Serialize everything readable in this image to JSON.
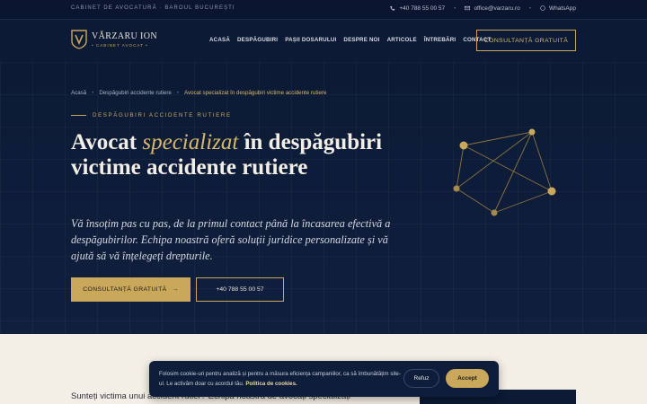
{
  "topbar": {
    "tagline": "CABINET DE AVOCATURĂ · BAROUL BUCUREȘTI",
    "phone": "+40 788 55 00 57",
    "email": "office@varzaru.ro",
    "whatsapp": "WhatsApp",
    "icons": [
      "phone-icon",
      "mail-icon",
      "whatsapp-icon"
    ]
  },
  "header": {
    "logo_name": "VĂRZARU ION",
    "logo_sub": "• CABINET AVOCAT •",
    "nav": [
      "ACASĂ",
      "DESPĂGUBIRI",
      "PAȘII DOSARULUI",
      "DESPRE NOI",
      "ARTICOLE",
      "ÎNTREBĂRI",
      "CONTACT"
    ],
    "cta": "CONSULTANȚĂ GRATUITĂ"
  },
  "hero": {
    "breadcrumb": [
      "Acasă",
      "Despăgubiri accidente rutiere",
      "Avocat specializat în despăgubiri victime accidente rutiere"
    ],
    "eyebrow": "DESPĂGUBIRI ACCIDENTE RUTIERE",
    "title_pre": "Avocat ",
    "title_em": "specializat",
    "title_post": " în despăgubiri victime accidente rutiere",
    "lead": "Vă însoțim pas cu pas, de la primul contact până la încasarea efectivă a despăgubirilor. Echipa noastră oferă soluții juridice personalizate și vă ajută să vă înțelegeți drepturile.",
    "primary_button": "CONSULTANȚĂ GRATUITĂ",
    "primary_arrow": "→",
    "secondary_button": "+40 788 55 00 57"
  },
  "lower": {
    "intro": "Sunteți victima unui accident rutier? Echipa noastră de avocați specializați"
  },
  "cookie": {
    "message": "Folosim cookie-uri pentru analiză și pentru a măsura eficiența campaniilor, ca să îmbunătățim site-ul. Le activăm doar cu acordul tău.",
    "policy_link": "Politica de cookies.",
    "refuse": "Refuz",
    "accept": "Accept"
  },
  "colors": {
    "navy": "#0c1a35",
    "gold": "#c9a85c",
    "cream": "#f4efe6"
  }
}
